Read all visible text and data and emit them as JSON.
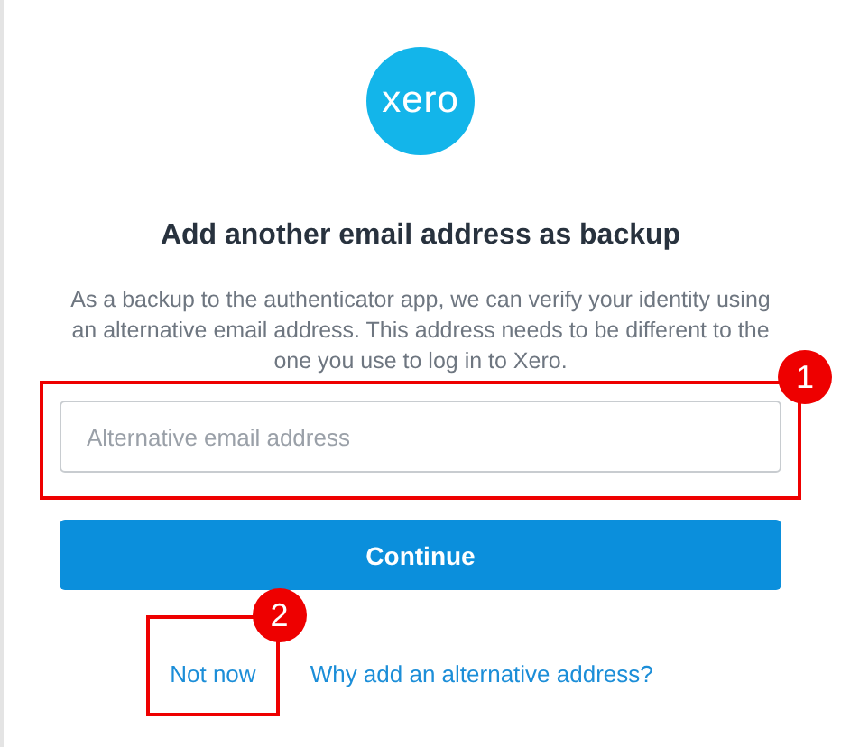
{
  "logo": {
    "text": "xero"
  },
  "title": "Add another email address as backup",
  "description": "As a backup to the authenticator app, we can verify your identity using an alternative email address. This address needs to be different to the one you use to log in to Xero.",
  "email_field": {
    "placeholder": "Alternative email address",
    "callout": "1"
  },
  "continue_button": "Continue",
  "links": [
    {
      "text": "Not now",
      "callout": "2"
    },
    {
      "text": "Why add an alternative address?"
    }
  ]
}
